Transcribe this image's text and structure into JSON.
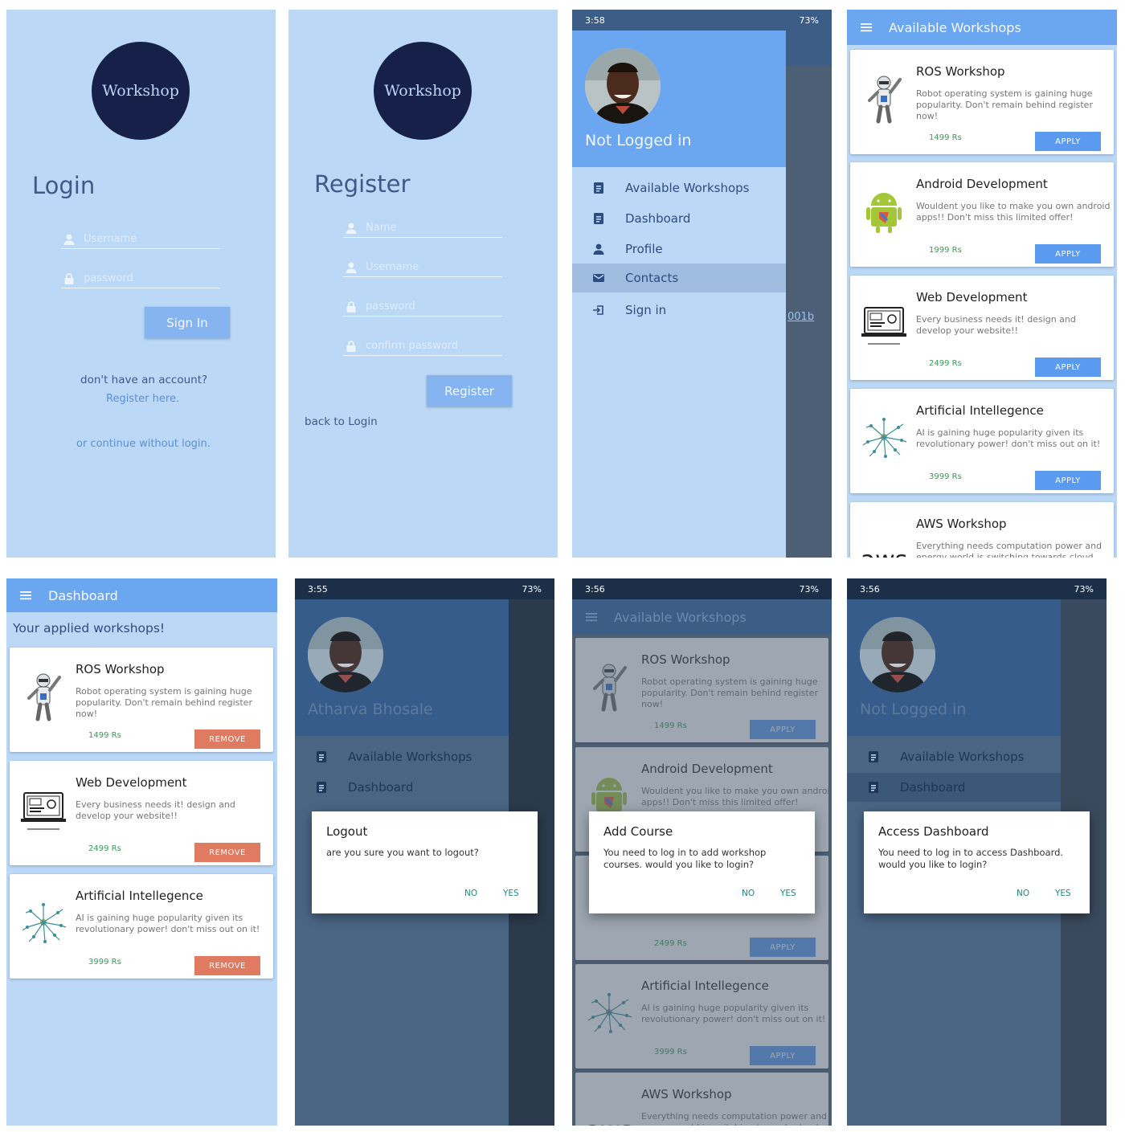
{
  "login": {
    "logo": "Workshop",
    "title": "Login",
    "username_placeholder": "Username",
    "password_placeholder": "password",
    "signin": "Sign In",
    "no_account": "don't have an account?",
    "register_link": "Register here.",
    "continue_link": "or continue without login."
  },
  "register": {
    "logo": "Workshop",
    "title": "Register",
    "name_placeholder": "Name",
    "username_placeholder": "Username",
    "password_placeholder": "password",
    "confirm_placeholder": "confirm password",
    "button": "Register",
    "back": "back to Login"
  },
  "drawer": {
    "status_time": "3:58",
    "status_battery": "73%",
    "user": "Not Logged in",
    "items": [
      {
        "label": "Available Workshops",
        "icon": "list-icon"
      },
      {
        "label": "Dashboard",
        "icon": "list-icon"
      },
      {
        "label": "Profile",
        "icon": "person-icon"
      },
      {
        "label": "Contacts",
        "icon": "mail-icon"
      },
      {
        "label": "Sign in",
        "icon": "signin-icon"
      }
    ],
    "peek_text": "001b"
  },
  "workshops": {
    "title": "Available Workshops",
    "apply": "APPLY",
    "cards": [
      {
        "title": "ROS Workshop",
        "desc": "Robot operating system is gaining huge popularity. Don't remain behind register now!",
        "price": "1499 Rs"
      },
      {
        "title": "Android Development",
        "desc": "Wouldent you like to make you own android apps!! Don't miss this limited offer!",
        "price": "1999 Rs"
      },
      {
        "title": "Web Development",
        "desc": "Every business needs it! design and develop your website!!",
        "price": "2499 Rs"
      },
      {
        "title": "Artificial Intellegence",
        "desc": "AI is gaining huge popularity given its revolutionary power! don't miss out on it!",
        "price": "3999 Rs"
      },
      {
        "title": "AWS Workshop",
        "desc": "Everything needs computation power and energy world is switching towards cloud",
        "price": ""
      }
    ],
    "aws_logo": "aws"
  },
  "dashboard": {
    "title": "Dashboard",
    "subtitle": "Your applied workshops!",
    "remove": "REMOVE",
    "cards": [
      {
        "title": "ROS Workshop",
        "desc": "Robot operating system is gaining huge popularity. Don't remain behind register now!",
        "price": "1499 Rs"
      },
      {
        "title": "Web Development",
        "desc": "Every business needs it! design and develop your website!!",
        "price": "2499 Rs"
      },
      {
        "title": "Artificial Intellegence",
        "desc": "AI is gaining huge popularity given its revolutionary power! don't miss out on it!",
        "price": "3999 Rs"
      }
    ]
  },
  "logout_screen": {
    "status_time": "3:55",
    "status_battery": "73%",
    "user": "Atharva Bhosale",
    "items": [
      "Available Workshops",
      "Dashboard"
    ],
    "dialog_title": "Logout",
    "dialog_msg": "are you sure you want to logout?",
    "no": "NO",
    "yes": "YES"
  },
  "addcourse_screen": {
    "status_time": "3:56",
    "status_battery": "73%",
    "appbar": "Available Workshops",
    "dialog_title": "Add Course",
    "dialog_msg": "You need to log in to add workshop courses. would you like to login?",
    "no": "NO",
    "yes": "YES"
  },
  "access_screen": {
    "status_time": "3:56",
    "status_battery": "73%",
    "user": "Not Logged in",
    "items": [
      "Available Workshops",
      "Dashboard"
    ],
    "dialog_title": "Access Dashboard",
    "dialog_msg": "You need to log in to access Dashboard. would you like to login?",
    "no": "NO",
    "yes": "YES"
  },
  "colors": {
    "bg": "#bbd8f7",
    "appbar": "#6ba6f0",
    "logo": "#162049",
    "apply": "#5a9bef",
    "remove": "#e07a60"
  }
}
